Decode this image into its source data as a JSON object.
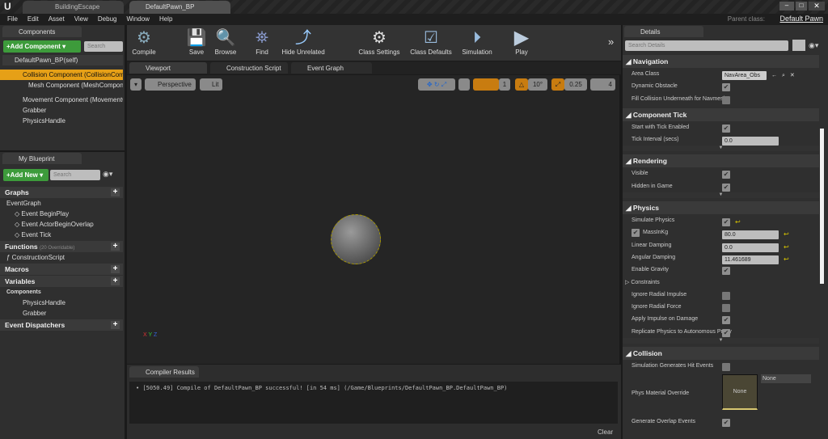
{
  "window": {
    "tabs": [
      "BuildingEscape",
      "DefaultPawn_BP"
    ],
    "parent_class_label": "Parent class:",
    "parent_class": "Default Pawn"
  },
  "menu": [
    "File",
    "Edit",
    "Asset",
    "View",
    "Debug",
    "Window",
    "Help"
  ],
  "components": {
    "tab": "Components",
    "add_label": "+Add Component",
    "search_placeholder": "Search",
    "self": "DefaultPawn_BP(self)",
    "items": [
      "Collision Component (CollisionComponent)",
      "Mesh Component (MeshComponent)",
      "Movement Component (MovementComponent)",
      "Grabber",
      "PhysicsHandle"
    ]
  },
  "my_blueprint": {
    "tab": "My Blueprint",
    "add_label": "+Add New",
    "search_placeholder": "Search",
    "graphs": "Graphs",
    "event_graph": "EventGraph",
    "events": [
      "Event BeginPlay",
      "Event ActorBeginOverlap",
      "Event Tick"
    ],
    "functions": "Functions",
    "functions_note": "(20 Overridable)",
    "construction": "ConstructionScript",
    "macros": "Macros",
    "variables": "Variables",
    "components_label": "Components",
    "vars": [
      "PhysicsHandle",
      "Grabber"
    ],
    "dispatchers": "Event Dispatchers"
  },
  "toolbar": [
    "Compile",
    "Save",
    "Browse",
    "Find",
    "Hide Unrelated",
    "Class Settings",
    "Class Defaults",
    "Simulation",
    "Play"
  ],
  "editor_tabs": [
    "Viewport",
    "Construction Script",
    "Event Graph"
  ],
  "viewport": {
    "perspective": "Perspective",
    "lit": "Lit",
    "grid_snap": "1",
    "rot_snap": "10°",
    "scale_snap": "0.25",
    "cam_speed": "4"
  },
  "compiler": {
    "tab": "Compiler Results",
    "message": "[5050.49] Compile of DefaultPawn_BP successful! [in 54 ms] (/Game/Blueprints/DefaultPawn_BP.DefaultPawn_BP)",
    "clear": "Clear"
  },
  "details": {
    "tab": "Details",
    "search_placeholder": "Search Details",
    "sections": [
      {
        "title": "Navigation",
        "rows": [
          {
            "label": "Area Class",
            "type": "combo",
            "value": "NavArea_Obs"
          },
          {
            "label": "Dynamic Obstacle",
            "type": "check",
            "value": true
          },
          {
            "label": "Fill Collision Underneath for Navmesh",
            "type": "check",
            "value": false
          }
        ]
      },
      {
        "title": "Component Tick",
        "rows": [
          {
            "label": "Start with Tick Enabled",
            "type": "check",
            "value": true
          },
          {
            "label": "Tick Interval (secs)",
            "type": "num",
            "value": "0.0"
          }
        ]
      },
      {
        "title": "Rendering",
        "rows": [
          {
            "label": "Visible",
            "type": "check",
            "value": true
          },
          {
            "label": "Hidden in Game",
            "type": "check",
            "value": true
          }
        ]
      },
      {
        "title": "Physics",
        "rows": [
          {
            "label": "Simulate Physics",
            "type": "check",
            "value": true,
            "reset": true
          },
          {
            "label": "MassInKg",
            "type": "num",
            "value": "80.0",
            "reset": true,
            "prefix_check": true
          },
          {
            "label": "Linear Damping",
            "type": "num",
            "value": "0.0",
            "reset": true
          },
          {
            "label": "Angular Damping",
            "type": "num",
            "value": "11.461689",
            "reset": true
          },
          {
            "label": "Enable Gravity",
            "type": "check",
            "value": true
          },
          {
            "label": "Constraints",
            "type": "group"
          },
          {
            "label": "Ignore Radial Impulse",
            "type": "check",
            "value": false
          },
          {
            "label": "Ignore Radial Force",
            "type": "check",
            "value": false
          },
          {
            "label": "Apply Impulse on Damage",
            "type": "check",
            "value": true
          },
          {
            "label": "Replicate Physics to Autonomous Proxy",
            "type": "check",
            "value": true
          }
        ]
      },
      {
        "title": "Collision",
        "rows": [
          {
            "label": "Simulation Generates Hit Events",
            "type": "check",
            "value": false
          },
          {
            "label": "Phys Material Override",
            "type": "asset",
            "value": "None",
            "combo": "None"
          },
          {
            "label": "Generate Overlap Events",
            "type": "check",
            "value": true
          }
        ]
      }
    ]
  }
}
